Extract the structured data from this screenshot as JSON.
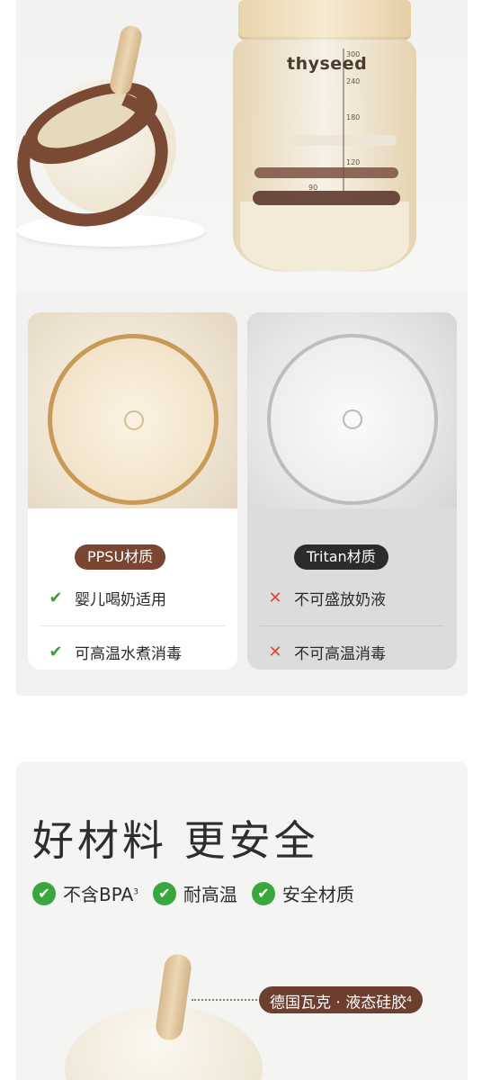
{
  "hero": {
    "brand_logo": "thyseed",
    "scale_ticks": [
      "300",
      "240",
      "180",
      "120",
      "90"
    ]
  },
  "compare": {
    "ppsu": {
      "label": "PPSU材质",
      "items": [
        {
          "icon": "check-icon",
          "text": "婴儿喝奶适用"
        },
        {
          "icon": "check-icon",
          "text": "可高温水煮消毒"
        }
      ]
    },
    "tritan": {
      "label": "Tritan材质",
      "items": [
        {
          "icon": "cross-icon",
          "text": "不可盛放奶液"
        },
        {
          "icon": "cross-icon",
          "text": "不可高温消毒"
        }
      ]
    }
  },
  "safety": {
    "headline": "好材料 更安全",
    "badges": [
      {
        "text": "不含BPA",
        "sup": "3"
      },
      {
        "text": "耐高温",
        "sup": ""
      },
      {
        "text": "安全材质",
        "sup": ""
      }
    ],
    "callout": {
      "text": "德国瓦克 · 液态硅胶",
      "sup": "4"
    }
  },
  "colors": {
    "accent_brown": "#7a4632",
    "dark_pill": "#2b2b2b",
    "check_green": "#3aa63e",
    "cross_red": "#e0482e"
  }
}
